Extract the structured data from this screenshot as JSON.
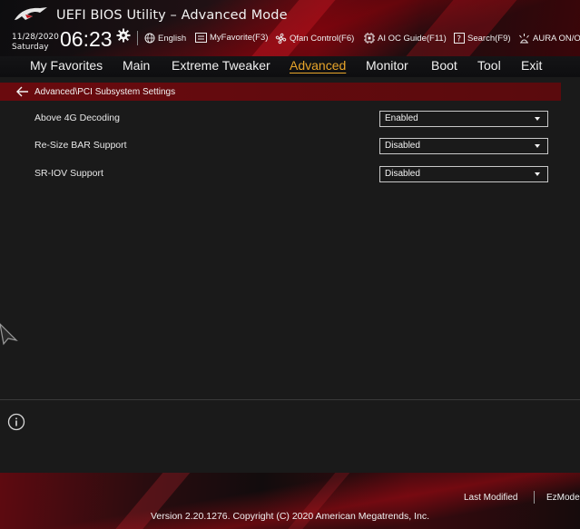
{
  "header": {
    "title": "UEFI BIOS Utility – Advanced Mode",
    "date": "11/28/2020",
    "day": "Saturday",
    "time": "06:23",
    "tools": [
      {
        "label": "English",
        "icon": "globe-icon"
      },
      {
        "label": "MyFavorite(F3)",
        "icon": "favorite-icon"
      },
      {
        "label": "Qfan Control(F6)",
        "icon": "fan-icon"
      },
      {
        "label": "AI OC Guide(F11)",
        "icon": "ai-oc-icon"
      },
      {
        "label": "Search(F9)",
        "icon": "search-icon"
      },
      {
        "label": "AURA ON/OFF",
        "icon": "aura-icon"
      }
    ]
  },
  "menu": {
    "items": [
      "My Favorites",
      "Main",
      "Extreme Tweaker",
      "Advanced",
      "Monitor",
      "Boot",
      "Tool",
      "Exit"
    ],
    "active": "Advanced"
  },
  "breadcrumb": "Advanced\\PCI Subsystem Settings",
  "settings": [
    {
      "label": "Above 4G Decoding",
      "value": "Enabled"
    },
    {
      "label": "Re-Size BAR Support",
      "value": "Disabled"
    },
    {
      "label": "SR-IOV Support",
      "value": "Disabled"
    }
  ],
  "footer": {
    "last_modified": "Last Modified",
    "ez_mode": "EzMode",
    "version": "Version 2.20.1276. Copyright (C) 2020 American Megatrends, Inc."
  },
  "colors": {
    "accent": "#e8a52a",
    "breadcrumb_bg": "#6a0a0e",
    "panel_bg": "#1a1a1a"
  }
}
